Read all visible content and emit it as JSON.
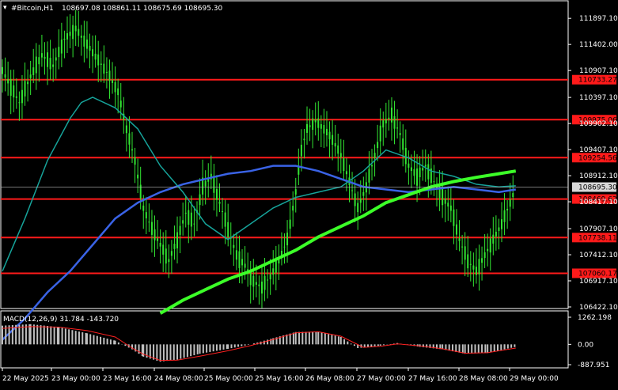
{
  "header": {
    "title": "#Bitcoin,H1",
    "ohlc": "108697.08 108861.11 108675.69 108695.30"
  },
  "macd": {
    "title": "MACD(12,26,9) 31.784 -143.720",
    "scale_labels": [
      "1262.198",
      "0.00",
      "-887.951"
    ]
  },
  "colors": {
    "background": "#000000",
    "axis": "#ffffff",
    "candle": "#32e632",
    "ma_fast": "#3a63e6",
    "ma_mid": "#16a39a",
    "ma_slow": "#3cff28",
    "level_line": "#ff1a1a",
    "level_label_bg": "#ff1a1a",
    "price_label_bg": "#d8d8d8",
    "macd_hist": "#c0c0c0",
    "macd_signal": "#ff2020"
  },
  "chart_data": {
    "type": "line",
    "title": "#Bitcoin,H1",
    "ylim": [
      106422,
      112200
    ],
    "y_ticks": [
      "111897.10",
      "111402.00",
      "110907.10",
      "110397.10",
      "109902.10",
      "109407.10",
      "108912.10",
      "108417.10",
      "107907.10",
      "107412.10",
      "106917.10",
      "106422.10"
    ],
    "x_labels": [
      "22 May 2025",
      "23 May 00:00",
      "23 May 16:00",
      "24 May 08:00",
      "25 May 00:00",
      "25 May 16:00",
      "26 May 08:00",
      "27 May 00:00",
      "27 May 16:00",
      "28 May 08:00",
      "29 May 00:00"
    ],
    "current_price": "108695.30",
    "levels": [
      "110733.27",
      "109975.06",
      "109254.56",
      "108469.62",
      "107738.11",
      "107060.17"
    ],
    "price_series": [
      [
        0,
        110900
      ],
      [
        3,
        110600
      ],
      [
        6,
        110300
      ],
      [
        10,
        110800
      ],
      [
        14,
        111200
      ],
      [
        18,
        111000
      ],
      [
        22,
        111500
      ],
      [
        26,
        111700
      ],
      [
        30,
        111400
      ],
      [
        34,
        111100
      ],
      [
        38,
        110800
      ],
      [
        41,
        110500
      ],
      [
        44,
        109800
      ],
      [
        47,
        109200
      ],
      [
        50,
        108300
      ],
      [
        53,
        107900
      ],
      [
        56,
        107600
      ],
      [
        59,
        107300
      ],
      [
        62,
        107700
      ],
      [
        65,
        108200
      ],
      [
        68,
        108000
      ],
      [
        71,
        108700
      ],
      [
        74,
        108900
      ],
      [
        77,
        108400
      ],
      [
        80,
        107900
      ],
      [
        83,
        107400
      ],
      [
        86,
        107200
      ],
      [
        89,
        106900
      ],
      [
        92,
        106800
      ],
      [
        95,
        107000
      ],
      [
        98,
        107300
      ],
      [
        101,
        107700
      ],
      [
        104,
        108600
      ],
      [
        106,
        109400
      ],
      [
        108,
        109800
      ],
      [
        111,
        109950
      ],
      [
        114,
        109800
      ],
      [
        117,
        109600
      ],
      [
        120,
        109300
      ],
      [
        123,
        108800
      ],
      [
        126,
        108300
      ],
      [
        129,
        108700
      ],
      [
        132,
        109300
      ],
      [
        135,
        109900
      ],
      [
        138,
        110050
      ],
      [
        141,
        109700
      ],
      [
        144,
        109100
      ],
      [
        147,
        108900
      ],
      [
        150,
        109100
      ],
      [
        153,
        108800
      ],
      [
        156,
        108500
      ],
      [
        159,
        108300
      ],
      [
        162,
        107700
      ],
      [
        165,
        107300
      ],
      [
        168,
        107100
      ],
      [
        171,
        107400
      ],
      [
        174,
        107700
      ],
      [
        177,
        108000
      ],
      [
        180,
        108400
      ],
      [
        182,
        108695
      ]
    ],
    "series": [
      {
        "name": "",
        "values": [
          [
            0,
            105800
          ],
          [
            8,
            106200
          ],
          [
            16,
            106700
          ],
          [
            24,
            107100
          ],
          [
            32,
            107600
          ],
          [
            40,
            108100
          ],
          [
            48,
            108400
          ],
          [
            56,
            108600
          ],
          [
            64,
            108750
          ],
          [
            72,
            108850
          ],
          [
            80,
            108950
          ],
          [
            88,
            109000
          ],
          [
            96,
            109100
          ],
          [
            104,
            109100
          ],
          [
            112,
            109000
          ],
          [
            120,
            108850
          ],
          [
            128,
            108700
          ],
          [
            136,
            108650
          ],
          [
            144,
            108600
          ],
          [
            152,
            108650
          ],
          [
            160,
            108700
          ],
          [
            168,
            108650
          ],
          [
            176,
            108600
          ],
          [
            182,
            108650
          ]
        ]
      },
      {
        "name": "",
        "values": [
          [
            0,
            107100
          ],
          [
            8,
            108100
          ],
          [
            16,
            109200
          ],
          [
            24,
            110000
          ],
          [
            28,
            110300
          ],
          [
            32,
            110400
          ],
          [
            40,
            110200
          ],
          [
            48,
            109800
          ],
          [
            56,
            109100
          ],
          [
            64,
            108600
          ],
          [
            72,
            108000
          ],
          [
            80,
            107700
          ],
          [
            88,
            108000
          ],
          [
            96,
            108300
          ],
          [
            104,
            108500
          ],
          [
            112,
            108600
          ],
          [
            120,
            108700
          ],
          [
            128,
            109000
          ],
          [
            136,
            109400
          ],
          [
            144,
            109250
          ],
          [
            152,
            109000
          ],
          [
            160,
            108900
          ],
          [
            168,
            108750
          ],
          [
            176,
            108700
          ],
          [
            182,
            108720
          ]
        ]
      },
      {
        "name": "",
        "values": [
          [
            56,
            106300
          ],
          [
            64,
            106550
          ],
          [
            72,
            106750
          ],
          [
            80,
            106950
          ],
          [
            88,
            107100
          ],
          [
            96,
            107300
          ],
          [
            104,
            107500
          ],
          [
            112,
            107750
          ],
          [
            120,
            107950
          ],
          [
            128,
            108150
          ],
          [
            136,
            108400
          ],
          [
            144,
            108550
          ],
          [
            152,
            108700
          ],
          [
            160,
            108800
          ],
          [
            168,
            108880
          ],
          [
            176,
            108950
          ],
          [
            182,
            109000
          ]
        ]
      }
    ],
    "macd": {
      "ylim": [
        -887.951,
        1262.198
      ],
      "histogram": [
        [
          0,
          760
        ],
        [
          10,
          820
        ],
        [
          20,
          700
        ],
        [
          30,
          450
        ],
        [
          40,
          150
        ],
        [
          46,
          -200
        ],
        [
          50,
          -500
        ],
        [
          56,
          -700
        ],
        [
          62,
          -620
        ],
        [
          70,
          -380
        ],
        [
          80,
          -180
        ],
        [
          88,
          0
        ],
        [
          96,
          250
        ],
        [
          104,
          500
        ],
        [
          112,
          520
        ],
        [
          120,
          300
        ],
        [
          126,
          -150
        ],
        [
          134,
          -50
        ],
        [
          140,
          50
        ],
        [
          148,
          -100
        ],
        [
          156,
          -200
        ],
        [
          164,
          -380
        ],
        [
          172,
          -350
        ],
        [
          178,
          -200
        ],
        [
          182,
          -100
        ]
      ],
      "signal": [
        [
          0,
          650
        ],
        [
          10,
          720
        ],
        [
          20,
          700
        ],
        [
          30,
          560
        ],
        [
          40,
          300
        ],
        [
          46,
          -150
        ],
        [
          50,
          -400
        ],
        [
          56,
          -650
        ],
        [
          62,
          -640
        ],
        [
          70,
          -480
        ],
        [
          80,
          -260
        ],
        [
          88,
          -50
        ],
        [
          96,
          200
        ],
        [
          104,
          470
        ],
        [
          112,
          510
        ],
        [
          120,
          330
        ],
        [
          128,
          -120
        ],
        [
          134,
          -80
        ],
        [
          140,
          20
        ],
        [
          148,
          -60
        ],
        [
          156,
          -180
        ],
        [
          164,
          -360
        ],
        [
          172,
          -340
        ],
        [
          178,
          -220
        ],
        [
          182,
          -150
        ]
      ],
      "grid": false
    },
    "xlabel": "",
    "ylabel": "",
    "grid": false
  }
}
